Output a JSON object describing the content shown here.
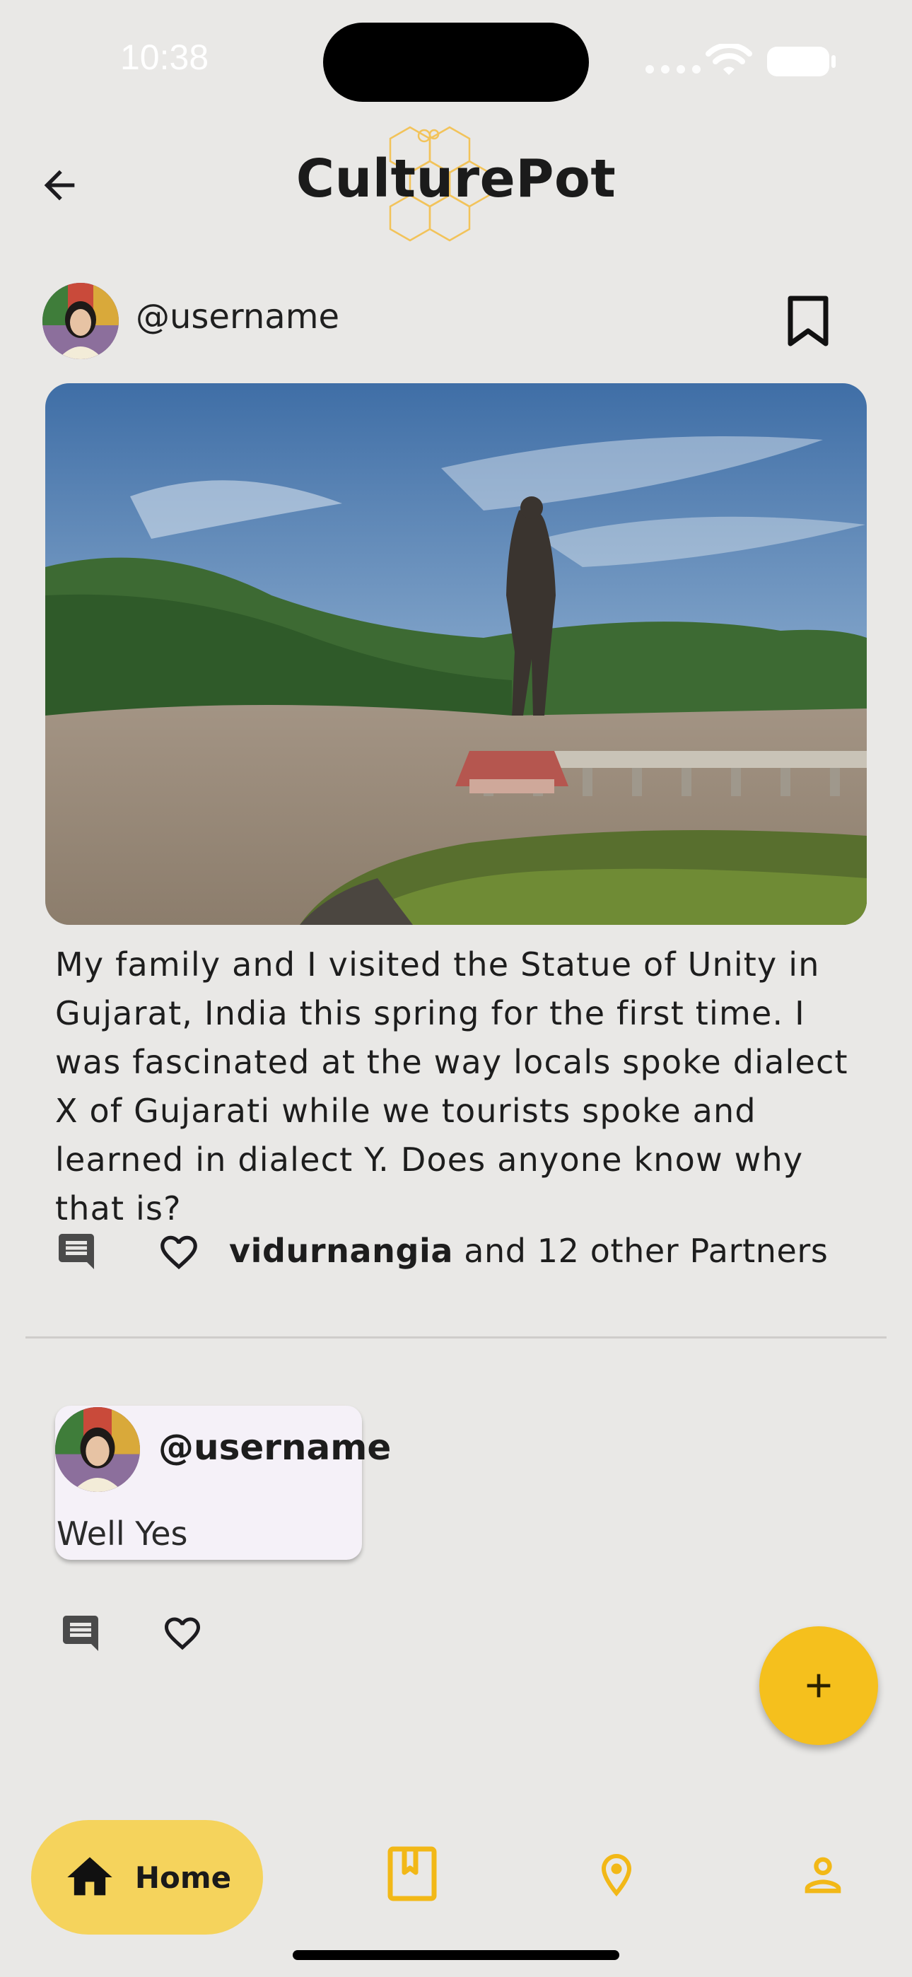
{
  "status_bar": {
    "time": "10:38"
  },
  "app_bar": {
    "title": "CulturePot"
  },
  "post": {
    "username": "@username",
    "image_alt": "Statue of Unity",
    "caption": "My family and I visited the Statue of Unity in Gujarat, India this spring for the first time. I was fascinated at the way locals spoke dialect X of Gujarati while we tourists spoke and learned in dialect Y. Does anyone know why that is?",
    "liked_by_user": "vidurnangia",
    "liked_by_rest": " and 12 other Partners"
  },
  "comment": {
    "username": "@username",
    "text": "Well Yes"
  },
  "bottom_nav": {
    "items": [
      {
        "label": "Home",
        "icon": "home-icon",
        "active": true
      },
      {
        "label": "",
        "icon": "book-icon",
        "active": false
      },
      {
        "label": "",
        "icon": "location-pin-icon",
        "active": false
      },
      {
        "label": "",
        "icon": "person-icon",
        "active": false
      }
    ]
  },
  "colors": {
    "background": "#e9e8e6",
    "accent": "#f5c01d",
    "nav_active": "#f5d35c",
    "nav_icon": "#f2b817",
    "comment_card": "#f5f1f8"
  }
}
